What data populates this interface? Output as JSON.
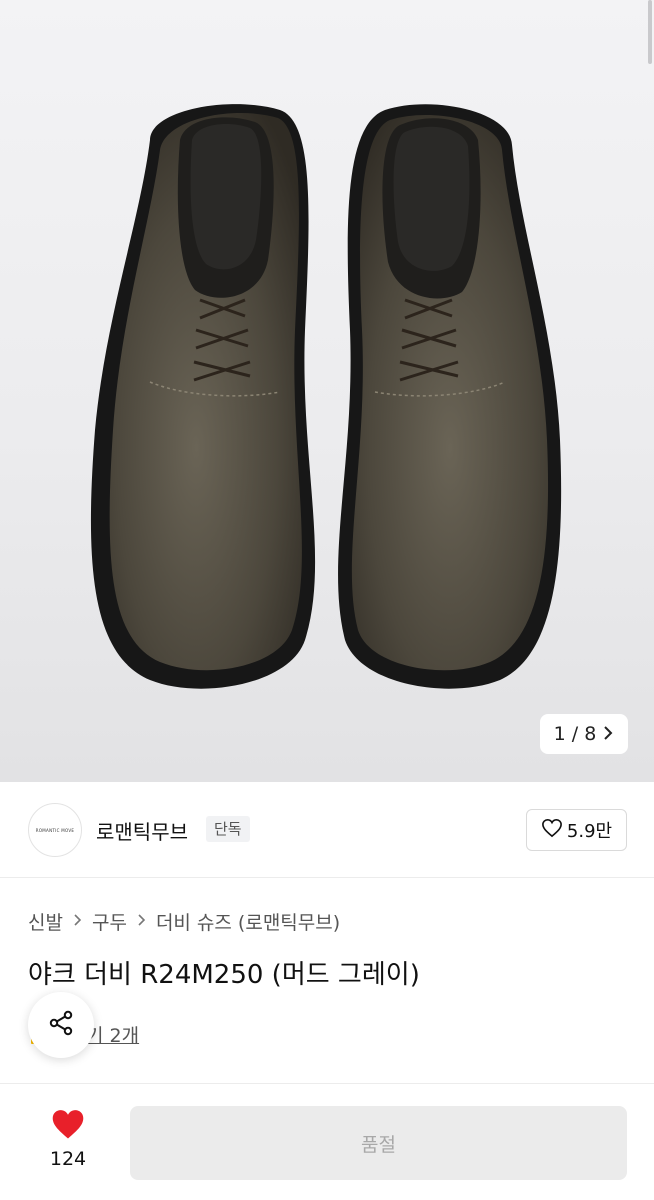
{
  "gallery": {
    "counter_text": "1 / 8",
    "next_icon": "chevron-right-icon",
    "shoe_color": "#4f4a3f",
    "sole_color": "#1b1b1b"
  },
  "brand": {
    "logo_text": "ROMANTIC MOVE",
    "name": "로맨틱무브",
    "badge": "단독",
    "like_count": "5.9만",
    "like_icon": "heart-outline-icon"
  },
  "breadcrumb": [
    "신발",
    "구두",
    "더비 슈즈 (로맨틱무브)"
  ],
  "product": {
    "title": "야크 더비 R24M250 (머드 그레이)",
    "review_link": "기 2개"
  },
  "share": {
    "icon": "share-icon"
  },
  "bottom_bar": {
    "wish_icon": "heart-filled-icon",
    "wish_color": "#e8202a",
    "wish_count": "124",
    "buy_label": "품절"
  }
}
